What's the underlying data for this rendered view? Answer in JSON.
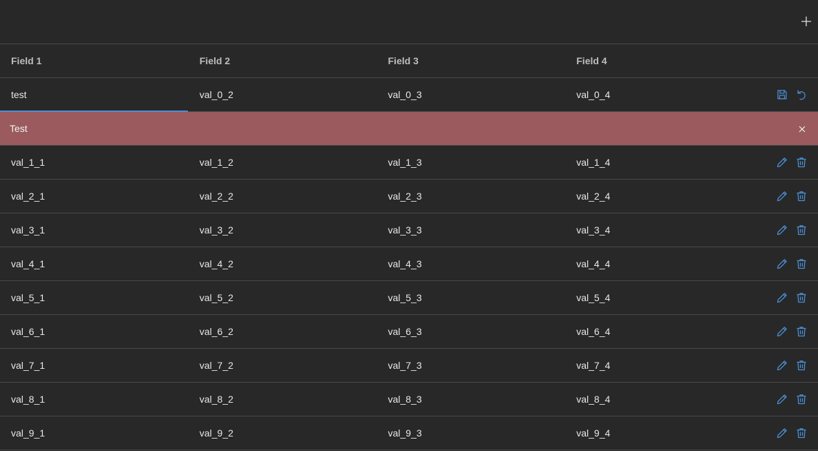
{
  "toolbar": {
    "add_icon": "plus-icon"
  },
  "table": {
    "headers": [
      "Field 1",
      "Field 2",
      "Field 3",
      "Field 4"
    ],
    "edit_row": {
      "field1_value": "test",
      "cells": [
        "val_0_2",
        "val_0_3",
        "val_0_4"
      ],
      "actions": [
        "save-icon",
        "undo-icon"
      ]
    },
    "error": {
      "message": "Test",
      "close_icon": "close-icon"
    },
    "rows": [
      [
        "val_1_1",
        "val_1_2",
        "val_1_3",
        "val_1_4"
      ],
      [
        "val_2_1",
        "val_2_2",
        "val_2_3",
        "val_2_4"
      ],
      [
        "val_3_1",
        "val_3_2",
        "val_3_3",
        "val_3_4"
      ],
      [
        "val_4_1",
        "val_4_2",
        "val_4_3",
        "val_4_4"
      ],
      [
        "val_5_1",
        "val_5_2",
        "val_5_3",
        "val_5_4"
      ],
      [
        "val_6_1",
        "val_6_2",
        "val_6_3",
        "val_6_4"
      ],
      [
        "val_7_1",
        "val_7_2",
        "val_7_3",
        "val_7_4"
      ],
      [
        "val_8_1",
        "val_8_2",
        "val_8_3",
        "val_8_4"
      ],
      [
        "val_9_1",
        "val_9_2",
        "val_9_3",
        "val_9_4"
      ]
    ],
    "row_actions": [
      "pencil-icon",
      "trash-icon"
    ]
  },
  "colors": {
    "accent": "#4a8fd6",
    "error_bg": "#9a5a5e",
    "background": "#282828",
    "border": "#4a4a4a"
  }
}
